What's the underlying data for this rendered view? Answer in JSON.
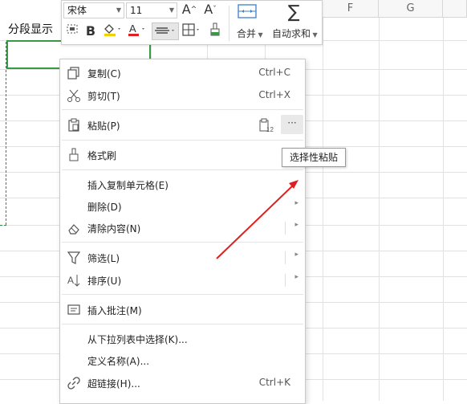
{
  "sheet": {
    "columns": [
      "F",
      "G"
    ],
    "cell_text": "分段显示"
  },
  "toolbar": {
    "font_name": "宋体",
    "font_size": "11",
    "grow_font": "A",
    "shrink_font": "A",
    "bold": "B",
    "merge_label": "合并",
    "autosum_label": "自动求和"
  },
  "menu": {
    "items": [
      {
        "label": "复制(C)",
        "shortcut": "Ctrl+C",
        "icon": "copy-icon"
      },
      {
        "label": "剪切(T)",
        "shortcut": "Ctrl+X",
        "icon": "scissors-icon"
      },
      {
        "label": "粘贴(P)",
        "icon": "clipboard-icon",
        "more": "···"
      },
      {
        "label": "格式刷",
        "icon": "brush-icon"
      },
      {
        "label": "插入复制单元格(E)"
      },
      {
        "label": "删除(D)"
      },
      {
        "label": "清除内容(N)",
        "icon": "eraser-icon"
      },
      {
        "label": "筛选(L)",
        "icon": "filter-icon"
      },
      {
        "label": "排序(U)",
        "icon": "sort-icon"
      },
      {
        "label": "插入批注(M)",
        "icon": "comment-icon"
      },
      {
        "label": "从下拉列表中选择(K)..."
      },
      {
        "label": "定义名称(A)..."
      },
      {
        "label": "超链接(H)...",
        "shortcut": "Ctrl+K",
        "icon": "link-icon"
      }
    ]
  },
  "tooltip": "选择性粘贴",
  "colors": {
    "selection_green": "#3a9a44",
    "arrow_red": "#e02020",
    "font_color_red": "#e02020",
    "highlight_yellow": "#f5d000"
  }
}
